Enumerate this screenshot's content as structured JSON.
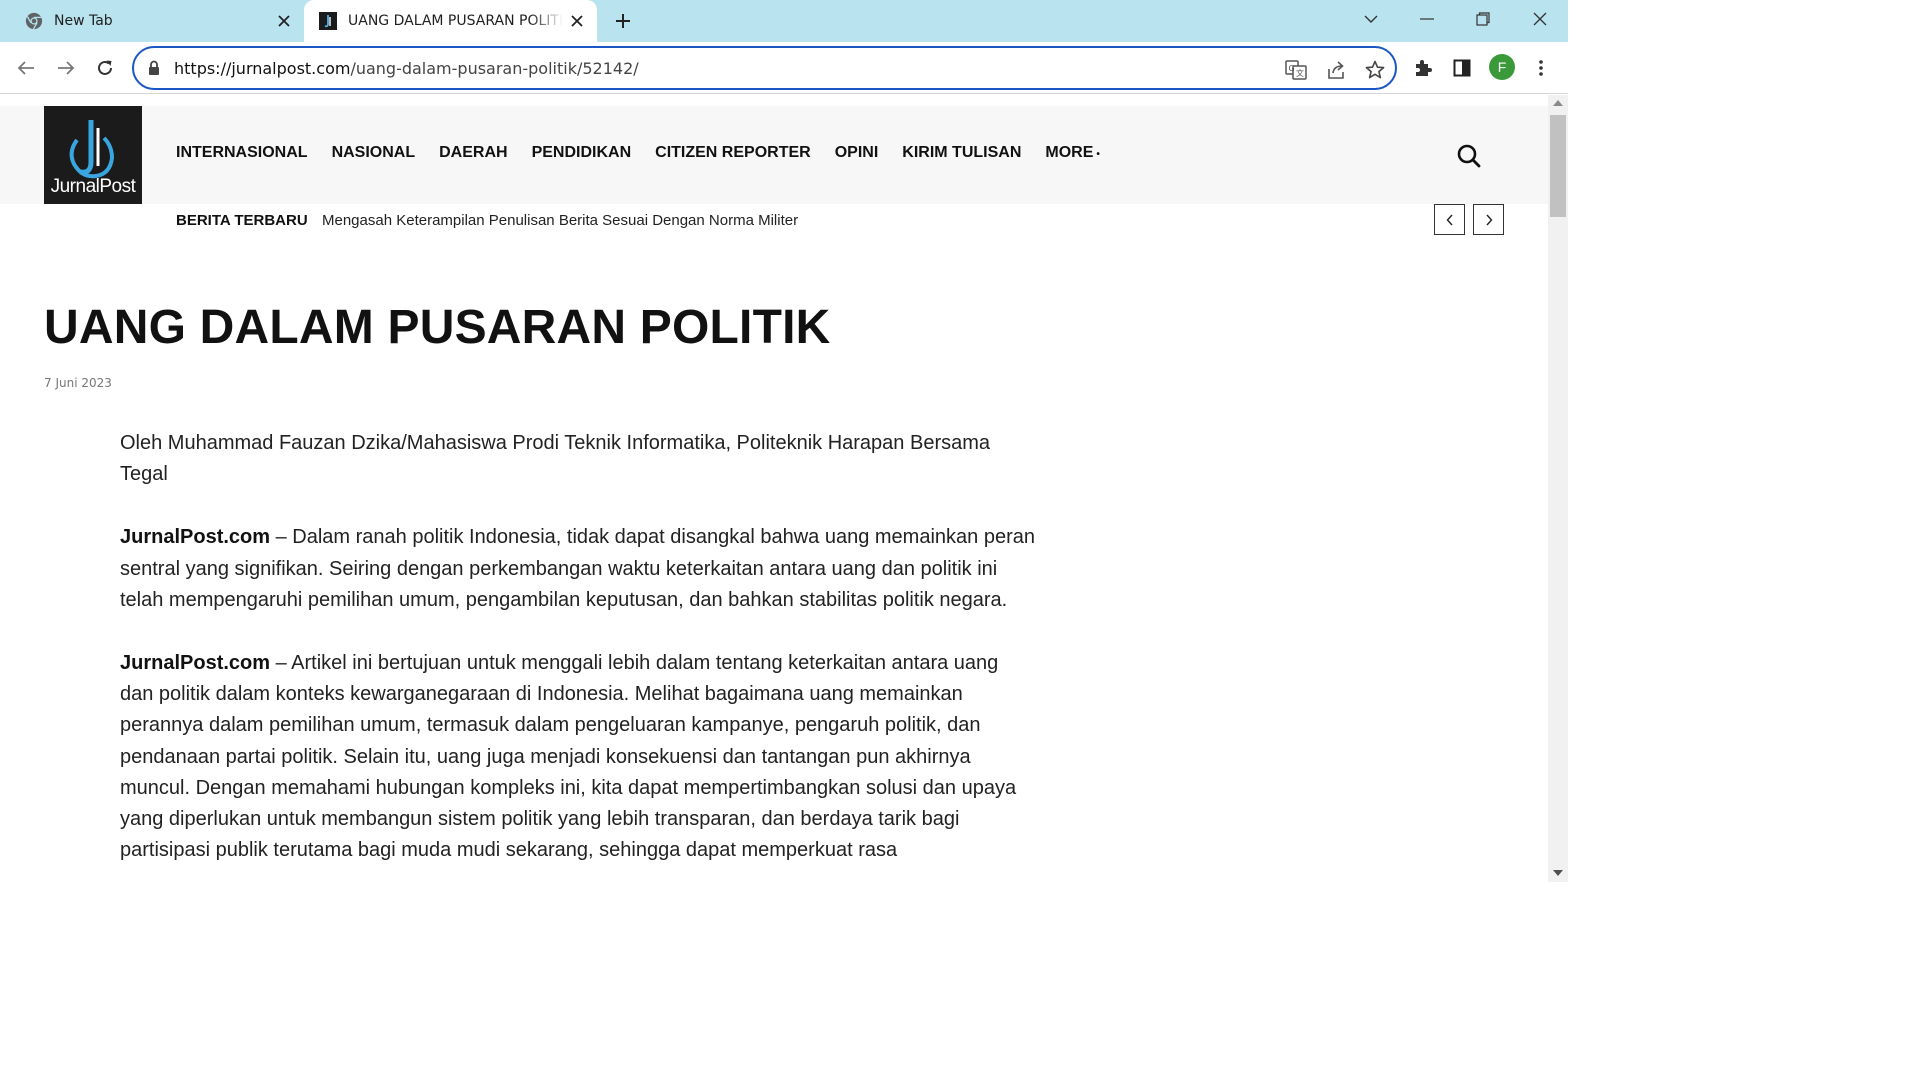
{
  "browser": {
    "tabs": [
      {
        "title": "New Tab",
        "icon": "chrome-icon"
      },
      {
        "title": "UANG DALAM PUSARAN POLITIK",
        "icon": "jurnalpost-favicon"
      }
    ],
    "new_tab": "+",
    "url_host": "https://jurnalpost.com",
    "url_path": "/uang-dalam-pusaran-politik/52142/",
    "profile_initial": "F",
    "colors": {
      "tabstrip": "#b8e3ef",
      "omnibox_border": "#1a56c4",
      "profile": "#3a9a3a"
    }
  },
  "site": {
    "logo_text": "JurnalPost",
    "nav": [
      {
        "label": "INTERNASIONAL"
      },
      {
        "label": "NASIONAL"
      },
      {
        "label": "DAERAH"
      },
      {
        "label": "PENDIDIKAN"
      },
      {
        "label": "CITIZEN REPORTER"
      },
      {
        "label": "OPINI"
      },
      {
        "label": "KIRIM TULISAN"
      },
      {
        "label": "MORE"
      }
    ],
    "ticker_label": "BERITA TERBARU",
    "ticker_headline": "Mengasah Keterampilan Penulisan Berita Sesuai Dengan Norma Militer"
  },
  "article": {
    "title": "UANG DALAM PUSARAN POLITIK",
    "date": "7 Juni 2023",
    "byline": "Oleh Muhammad Fauzan Dzika/Mahasiswa Prodi Teknik Informatika, Politeknik Harapan Bersama Tegal",
    "paragraphs": [
      {
        "lead": "JurnalPost.com",
        "text": " – Dalam ranah politik Indonesia, tidak dapat disangkal bahwa uang memainkan peran sentral yang signifikan. Seiring dengan perkembangan waktu keterkaitan antara uang dan politik ini telah mempengaruhi pemilihan umum, pengambilan keputusan, dan bahkan stabilitas politik negara."
      },
      {
        "lead": "JurnalPost.com",
        "text": " – Artikel ini bertujuan untuk menggali lebih dalam tentang keterkaitan antara uang dan politik dalam konteks kewarganegaraan di Indonesia. Melihat bagaimana uang memainkan perannya dalam pemilihan umum, termasuk dalam pengeluaran kampanye, pengaruh politik, dan pendanaan partai politik. Selain itu, uang juga menjadi konsekuensi dan tantangan pun akhirnya muncul. Dengan memahami hubungan kompleks ini, kita dapat mempertimbangkan solusi dan upaya yang diperlukan untuk membangun sistem politik yang lebih transparan, dan berdaya tarik bagi partisipasi publik terutama bagi muda mudi sekarang, sehingga dapat memperkuat rasa"
      }
    ]
  }
}
